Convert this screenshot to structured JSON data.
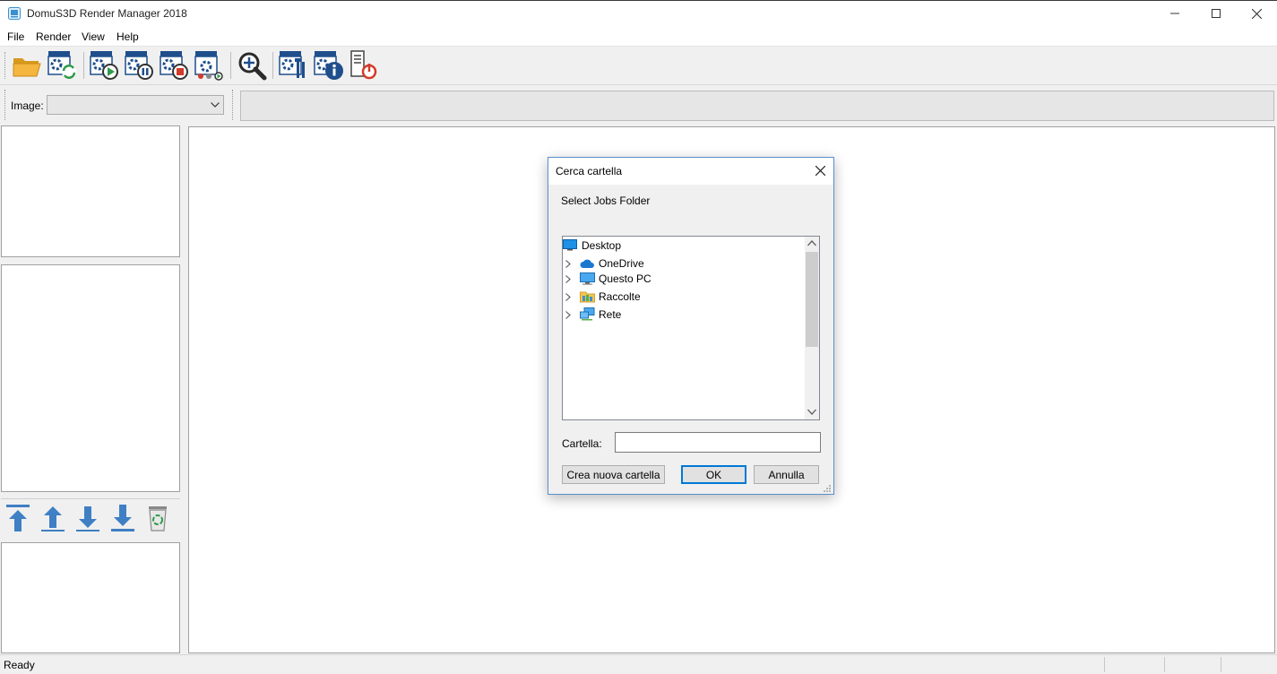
{
  "window": {
    "title": "DomuS3D Render Manager 2018"
  },
  "menu": [
    {
      "label": "File"
    },
    {
      "label": "Render"
    },
    {
      "label": "View"
    },
    {
      "label": "Help"
    }
  ],
  "toolbar": {
    "icons": [
      "open-folder-icon",
      "refresh-settings-icon",
      "start-render-icon",
      "pause-render-icon",
      "stop-render-icon",
      "network-render-icon",
      "zoom-icon",
      "settings-tools-icon",
      "info-icon",
      "shutdown-icon"
    ]
  },
  "image_bar": {
    "label": "Image:",
    "selected": ""
  },
  "queue_toolbar": {
    "icons": [
      "move-top-icon",
      "move-up-icon",
      "move-down-icon",
      "move-bottom-icon",
      "recycle-bin-icon"
    ]
  },
  "status": {
    "text": "Ready"
  },
  "dialog": {
    "title": "Cerca cartella",
    "description": "Select Jobs Folder",
    "tree": [
      {
        "label": "Desktop",
        "icon": "desktop-icon",
        "level": 0
      },
      {
        "label": "OneDrive",
        "icon": "cloud-icon",
        "level": 1
      },
      {
        "label": "Questo PC",
        "icon": "computer-icon",
        "level": 1
      },
      {
        "label": "Raccolte",
        "icon": "library-folder-icon",
        "level": 1
      },
      {
        "label": "Rete",
        "icon": "network-icon",
        "level": 1
      }
    ],
    "folder_label": "Cartella:",
    "folder_value": "",
    "new_folder_button": "Crea nuova cartella",
    "ok_button": "OK",
    "cancel_button": "Annulla"
  }
}
